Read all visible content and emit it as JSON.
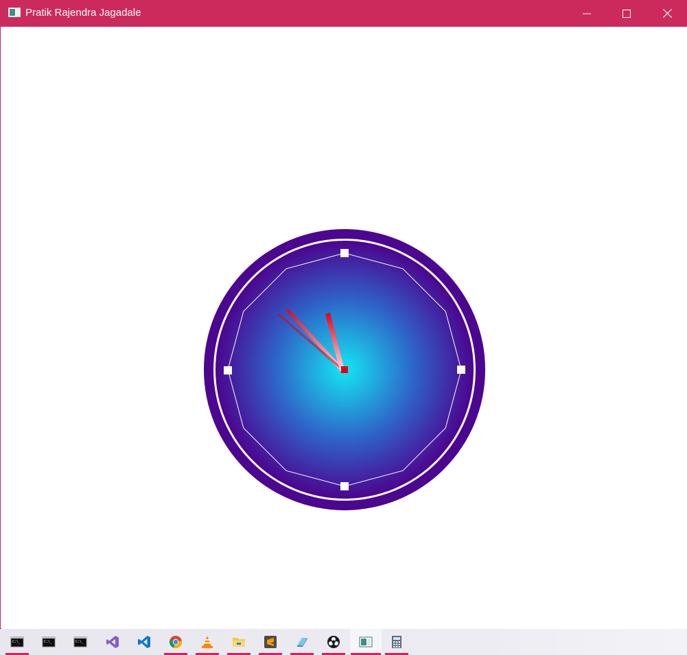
{
  "window": {
    "title": "Pratik Rajendra Jagadale",
    "icon": "app-window-icon",
    "controls": {
      "minimize": "minimize-icon",
      "maximize": "maximize-icon",
      "close": "close-icon"
    }
  },
  "clock": {
    "hour_markers": [
      "12",
      "3",
      "6",
      "9"
    ],
    "colors": {
      "bezel": "#4b0790",
      "ring": "#ffffff",
      "face_center": "#14e6f2",
      "face_mid": "#2e55c4",
      "face_edge": "#4b0790",
      "hand": "#e3001b",
      "center_dot": "#e3001b",
      "markers": "#ffffff"
    }
  },
  "taskbar": {
    "items": [
      {
        "icon": "command-prompt-icon",
        "running": true
      },
      {
        "icon": "command-prompt-icon",
        "running": false
      },
      {
        "icon": "command-prompt-icon",
        "running": false
      },
      {
        "icon": "visual-studio-icon",
        "running": false
      },
      {
        "icon": "vscode-icon",
        "running": false
      },
      {
        "icon": "chrome-icon",
        "running": true
      },
      {
        "icon": "vlc-icon",
        "running": true
      },
      {
        "icon": "file-explorer-icon",
        "running": true
      },
      {
        "icon": "sublime-text-icon",
        "running": true
      },
      {
        "icon": "notepad-icon",
        "running": true
      },
      {
        "icon": "obs-icon",
        "running": true
      },
      {
        "icon": "app-window-icon",
        "running": true,
        "active": true
      },
      {
        "icon": "calculator-icon",
        "running": true
      }
    ],
    "accent": "#c9285a"
  }
}
